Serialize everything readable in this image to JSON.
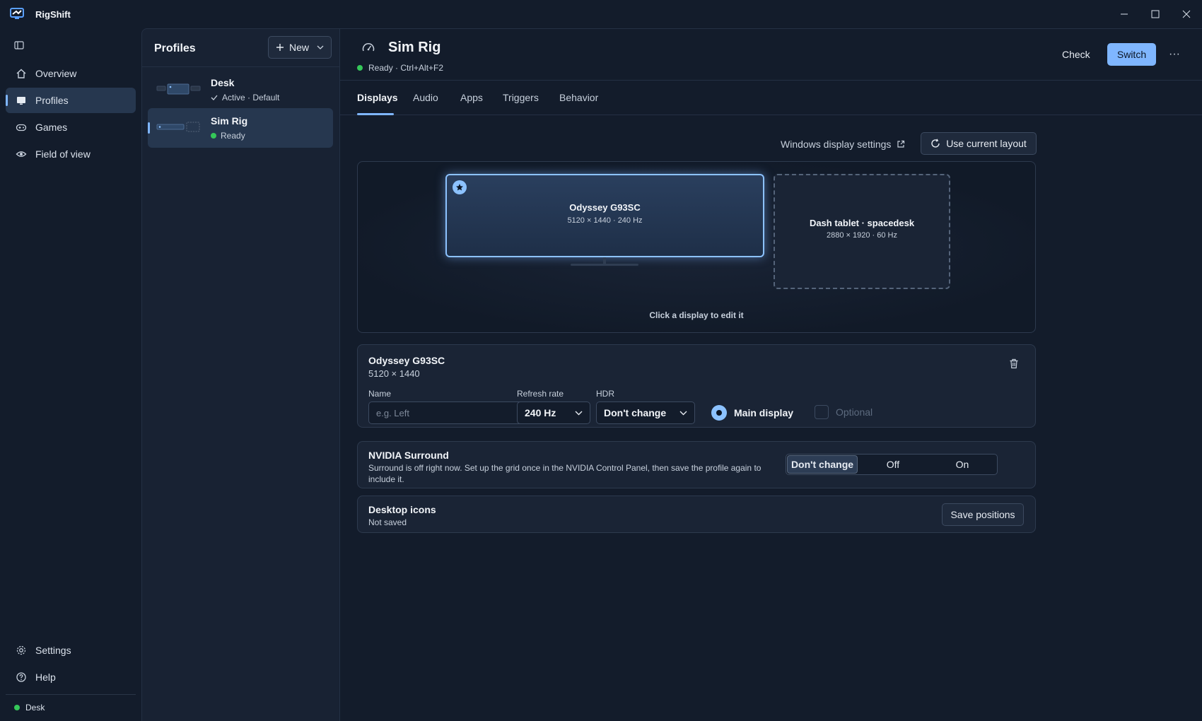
{
  "app": {
    "title": "RigShift"
  },
  "window": {
    "minimize_icon": "minimize-icon",
    "maximize_icon": "maximize-icon",
    "close_icon": "close-icon"
  },
  "nav": {
    "items": [
      {
        "label": "Overview",
        "icon": "home-icon"
      },
      {
        "label": "Profiles",
        "icon": "monitor-icon",
        "selected": true
      },
      {
        "label": "Games",
        "icon": "gamepad-icon"
      },
      {
        "label": "Field of view",
        "icon": "eye-icon"
      }
    ],
    "bottom": [
      {
        "label": "Settings",
        "icon": "gear-icon"
      },
      {
        "label": "Help",
        "icon": "help-icon"
      }
    ],
    "status": {
      "label": "Desk",
      "color": "#35c759"
    }
  },
  "profiles": {
    "title": "Profiles",
    "new_label": "New",
    "items": [
      {
        "name": "Desk",
        "status": "Active · Default"
      },
      {
        "name": "Sim Rig",
        "status": "Ready"
      }
    ]
  },
  "header": {
    "title": "Sim Rig",
    "status": "Ready · Ctrl+Alt+F2",
    "check_label": "Check",
    "switch_label": "Switch",
    "more_label": "···"
  },
  "tabs": [
    "Displays",
    "Audio",
    "Apps",
    "Triggers",
    "Behavior"
  ],
  "displays": {
    "windows_settings": "Windows display settings",
    "use_current": "Use current layout",
    "hint": "Click a display to edit it",
    "monitors": [
      {
        "name": "Odyssey G93SC",
        "spec": "5120 × 1440 · 240 Hz",
        "main": true
      },
      {
        "name": "Dash tablet · spacedesk",
        "spec": "2880 × 1920 · 60 Hz",
        "main": false
      }
    ]
  },
  "detail": {
    "title": "Odyssey G93SC",
    "resolution": "5120 × 1440",
    "name_label": "Name",
    "name_placeholder": "e.g. Left",
    "refresh_label": "Refresh rate",
    "refresh_value": "240 Hz",
    "hdr_label": "HDR",
    "hdr_value": "Don't change",
    "main_display": "Main display",
    "optional": "Optional"
  },
  "surround": {
    "title": "NVIDIA Surround",
    "description": "Surround is off right now. Set up the grid once in the NVIDIA Control Panel, then save the profile again to include it.",
    "options": [
      "Don't change",
      "Off",
      "On"
    ],
    "selected": "Don't change"
  },
  "icons_card": {
    "title": "Desktop icons",
    "status": "Not saved",
    "save_label": "Save positions"
  },
  "colors": {
    "accent": "#7fb6ff",
    "ready": "#35c759",
    "background": "#131c2b"
  }
}
